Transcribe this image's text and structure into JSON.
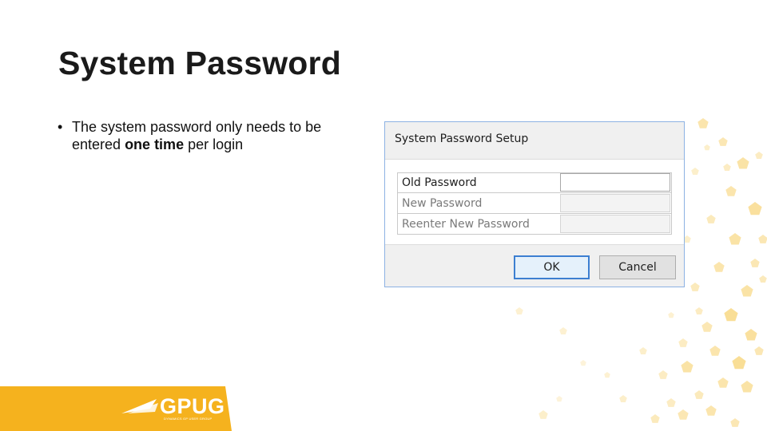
{
  "slide": {
    "title": "System Password",
    "bullet_dot": "•",
    "bullet_text_before": "The system password only needs to be entered ",
    "bullet_text_bold": "one time",
    "bullet_text_after": " per login"
  },
  "dialog": {
    "title": "System Password Setup",
    "fields": [
      {
        "label": "Old Password",
        "value": "",
        "enabled": true
      },
      {
        "label": "New Password",
        "value": "",
        "enabled": false
      },
      {
        "label": "Reenter New Password",
        "value": "",
        "enabled": false
      }
    ],
    "ok_label": "OK",
    "cancel_label": "Cancel"
  },
  "footer": {
    "logo_text": "GPUG",
    "logo_subtext": "DYNAMICS GP USER GROUP"
  },
  "colors": {
    "accent_yellow": "#f5b21e",
    "pattern_yellow": "#f7d06a",
    "dialog_border": "#8db2e3",
    "ok_focus": "#3c7fd1"
  }
}
